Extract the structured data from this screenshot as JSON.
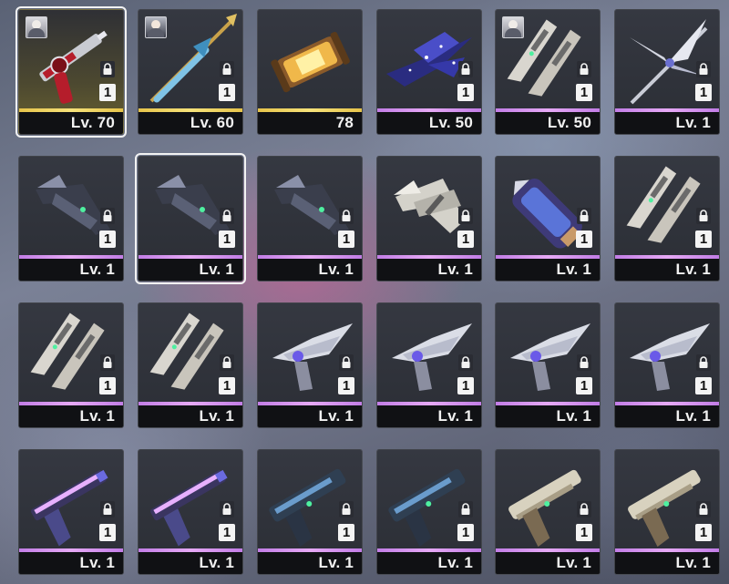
{
  "inventory": {
    "items": [
      {
        "level": "Lv. 70",
        "count": "1",
        "avatar": "silver-hair-character",
        "art": "red-revolver",
        "rarity": "gold",
        "selected": true
      },
      {
        "level": "Lv. 60",
        "count": "1",
        "avatar": "dark-hair-character",
        "art": "blue-gold-spear",
        "rarity": "gold",
        "selected": false
      },
      {
        "level": "78",
        "count": "",
        "avatar": "",
        "art": "golden-capsule",
        "rarity": "gold",
        "selected": false
      },
      {
        "level": "Lv. 50",
        "count": "1",
        "avatar": "",
        "art": "starry-blade-launcher",
        "rarity": "purple",
        "selected": false
      },
      {
        "level": "Lv. 50",
        "count": "1",
        "avatar": "black-hair-character",
        "art": "twin-blade-pods",
        "rarity": "purple",
        "selected": false
      },
      {
        "level": "Lv. 1",
        "count": "1",
        "avatar": "",
        "art": "winged-spear",
        "rarity": "purple",
        "selected": false
      },
      {
        "level": "Lv. 1",
        "count": "1",
        "avatar": "",
        "art": "dark-crossbow",
        "rarity": "purple",
        "selected": false
      },
      {
        "level": "Lv. 1",
        "count": "1",
        "avatar": "",
        "art": "dark-crossbow",
        "rarity": "purple",
        "selected": true
      },
      {
        "level": "Lv. 1",
        "count": "1",
        "avatar": "",
        "art": "dark-crossbow",
        "rarity": "purple",
        "selected": false
      },
      {
        "level": "Lv. 1",
        "count": "1",
        "avatar": "",
        "art": "white-crossbow",
        "rarity": "purple",
        "selected": false
      },
      {
        "level": "Lv. 1",
        "count": "1",
        "avatar": "",
        "art": "blue-gauntlet",
        "rarity": "purple",
        "selected": false
      },
      {
        "level": "Lv. 1",
        "count": "1",
        "avatar": "",
        "art": "twin-blade-pods",
        "rarity": "purple",
        "selected": false
      },
      {
        "level": "Lv. 1",
        "count": "1",
        "avatar": "",
        "art": "twin-blade-pods",
        "rarity": "purple",
        "selected": false
      },
      {
        "level": "Lv. 1",
        "count": "1",
        "avatar": "",
        "art": "twin-blade-pods",
        "rarity": "purple",
        "selected": false
      },
      {
        "level": "Lv. 1",
        "count": "1",
        "avatar": "",
        "art": "winged-pistol",
        "rarity": "purple",
        "selected": false
      },
      {
        "level": "Lv. 1",
        "count": "1",
        "avatar": "",
        "art": "winged-pistol",
        "rarity": "purple",
        "selected": false
      },
      {
        "level": "Lv. 1",
        "count": "1",
        "avatar": "",
        "art": "winged-pistol",
        "rarity": "purple",
        "selected": false
      },
      {
        "level": "Lv. 1",
        "count": "1",
        "avatar": "",
        "art": "winged-pistol",
        "rarity": "purple",
        "selected": false
      },
      {
        "level": "Lv. 1",
        "count": "1",
        "avatar": "",
        "art": "violet-pistol",
        "rarity": "purple",
        "selected": false
      },
      {
        "level": "Lv. 1",
        "count": "1",
        "avatar": "",
        "art": "violet-pistol",
        "rarity": "purple",
        "selected": false
      },
      {
        "level": "Lv. 1",
        "count": "1",
        "avatar": "",
        "art": "teal-pistol",
        "rarity": "purple",
        "selected": false
      },
      {
        "level": "Lv. 1",
        "count": "1",
        "avatar": "",
        "art": "teal-pistol",
        "rarity": "purple",
        "selected": false
      },
      {
        "level": "Lv. 1",
        "count": "1",
        "avatar": "",
        "art": "bone-pistol",
        "rarity": "purple",
        "selected": false
      },
      {
        "level": "Lv. 1",
        "count": "1",
        "avatar": "",
        "art": "bone-pistol",
        "rarity": "purple",
        "selected": false
      }
    ]
  },
  "colors": {
    "rarity_gold": "#e6c34a",
    "rarity_purple": "#d58ff0",
    "slot_bg": "#2e3138",
    "selected_border": "#f2f2f2"
  }
}
